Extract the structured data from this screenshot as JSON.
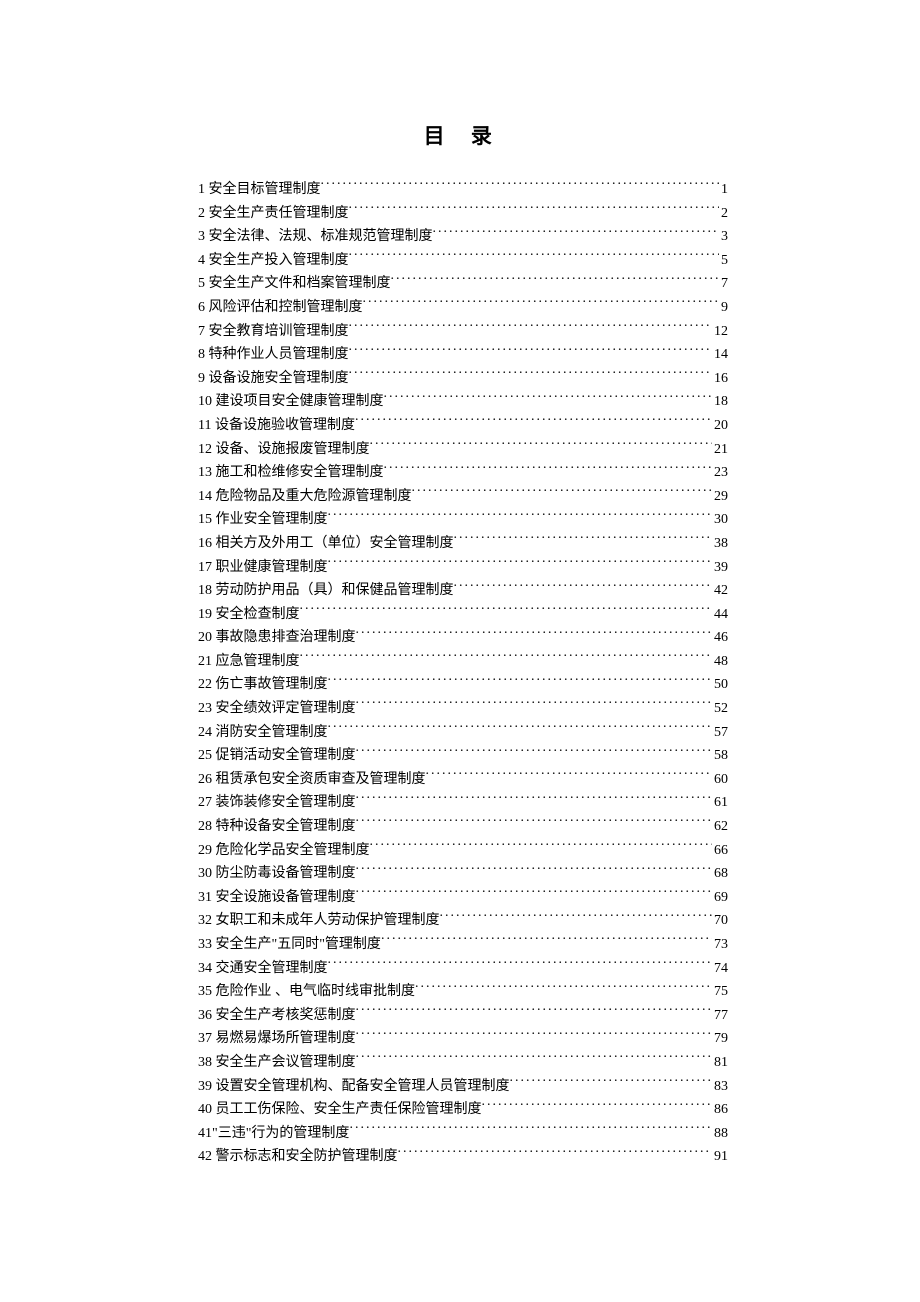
{
  "title": "目 录",
  "toc": [
    {
      "label": "1 安全目标管理制度",
      "page": "1"
    },
    {
      "label": "2 安全生产责任管理制度",
      "page": "2"
    },
    {
      "label": "3 安全法律、法规、标准规范管理制度",
      "page": "3"
    },
    {
      "label": "4 安全生产投入管理制度",
      "page": "5"
    },
    {
      "label": "5 安全生产文件和档案管理制度",
      "page": "7"
    },
    {
      "label": "6 风险评估和控制管理制度",
      "page": "9"
    },
    {
      "label": "7 安全教育培训管理制度",
      "page": "12"
    },
    {
      "label": "8 特种作业人员管理制度",
      "page": "14"
    },
    {
      "label": "9 设备设施安全管理制度",
      "page": "16"
    },
    {
      "label": "10 建设项目安全健康管理制度",
      "page": "18"
    },
    {
      "label": "11 设备设施验收管理制度",
      "page": "20"
    },
    {
      "label": "12 设备、设施报废管理制度",
      "page": "21"
    },
    {
      "label": "13 施工和检维修安全管理制度",
      "page": "23"
    },
    {
      "label": "14 危险物品及重大危险源管理制度",
      "page": "29"
    },
    {
      "label": "15 作业安全管理制度",
      "page": "30"
    },
    {
      "label": "16 相关方及外用工（单位）安全管理制度",
      "page": "38"
    },
    {
      "label": "17 职业健康管理制度",
      "page": "39"
    },
    {
      "label": "18 劳动防护用品（具）和保健品管理制度",
      "page": "42"
    },
    {
      "label": "19 安全检查制度",
      "page": "44"
    },
    {
      "label": "20 事故隐患排查治理制度",
      "page": "46"
    },
    {
      "label": "21 应急管理制度",
      "page": "48"
    },
    {
      "label": "22 伤亡事故管理制度",
      "page": "50"
    },
    {
      "label": "23 安全绩效评定管理制度",
      "page": "52"
    },
    {
      "label": "24 消防安全管理制度",
      "page": "57"
    },
    {
      "label": "25 促销活动安全管理制度",
      "page": "58"
    },
    {
      "label": "26 租赁承包安全资质审查及管理制度",
      "page": "60"
    },
    {
      "label": "27 装饰装修安全管理制度",
      "page": "61"
    },
    {
      "label": "28 特种设备安全管理制度",
      "page": "62"
    },
    {
      "label": "29 危险化学品安全管理制度",
      "page": "66"
    },
    {
      "label": "30 防尘防毒设备管理制度",
      "page": "68"
    },
    {
      "label": "31 安全设施设备管理制度",
      "page": "69"
    },
    {
      "label": "32 女职工和未成年人劳动保护管理制度",
      "page": "70"
    },
    {
      "label": "33 安全生产\"五同时\"管理制度",
      "page": "73"
    },
    {
      "label": "34 交通安全管理制度",
      "page": "74"
    },
    {
      "label": "35 危险作业 、电气临时线审批制度",
      "page": "75"
    },
    {
      "label": "36 安全生产考核奖惩制度",
      "page": "77"
    },
    {
      "label": "37 易燃易爆场所管理制度",
      "page": "79"
    },
    {
      "label": "38 安全生产会议管理制度",
      "page": "81"
    },
    {
      "label": "39 设置安全管理机构、配备安全管理人员管理制度",
      "page": "83"
    },
    {
      "label": "40 员工工伤保险、安全生产责任保险管理制度",
      "page": "86"
    },
    {
      "label": "41\"三违\"行为的管理制度",
      "page": "88"
    },
    {
      "label": "42 警示标志和安全防护管理制度",
      "page": "91"
    }
  ]
}
